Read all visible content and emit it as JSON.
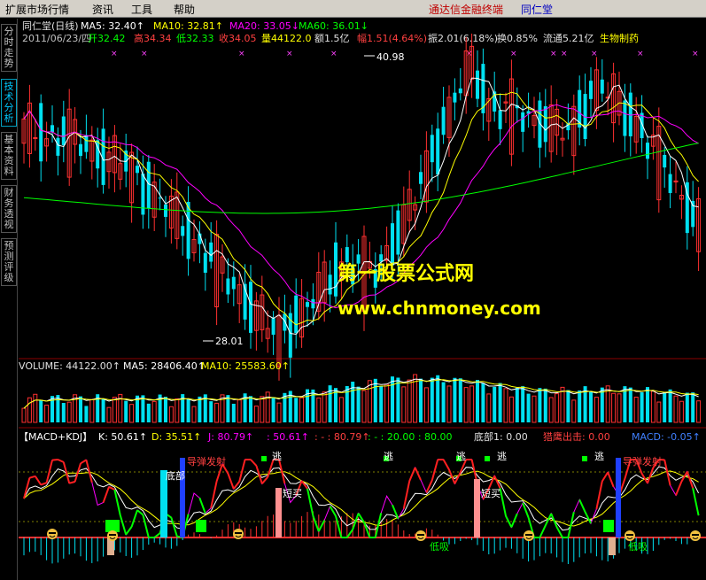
{
  "menu": {
    "items": [
      "扩展市场行情",
      "资讯",
      "工具",
      "帮助"
    ],
    "brand": "通达信金融终端",
    "stock": "同仁堂"
  },
  "side_tabs": [
    {
      "label": "分时走势",
      "active": false
    },
    {
      "label": "技术分析",
      "active": true
    },
    {
      "label": "基本资料",
      "active": false
    },
    {
      "label": "财务透视",
      "active": false
    },
    {
      "label": "预测评级",
      "active": false
    }
  ],
  "header": {
    "line1": [
      {
        "text": "同仁堂(日线)",
        "color": "#e0e0e0"
      },
      {
        "text": "MA5: 32.40↑",
        "color": "#ffffff"
      },
      {
        "text": "MA10: 32.81↑",
        "color": "#ffff00"
      },
      {
        "text": "MA20: 33.05↓",
        "color": "#ff00ff"
      },
      {
        "text": "MA60: 36.01↓",
        "color": "#00ff00"
      }
    ],
    "line2": [
      {
        "text": "2011/06/23/四",
        "color": "#c0c0c0"
      },
      {
        "text": "开32.42",
        "color": "#00ff00"
      },
      {
        "text": "高34.34",
        "color": "#ff4040"
      },
      {
        "text": "低32.33",
        "color": "#00ff00"
      },
      {
        "text": "收34.05",
        "color": "#ff4040"
      },
      {
        "text": "量44122.0",
        "color": "#ffff00"
      },
      {
        "text": "额1.5亿",
        "color": "#e0e0e0"
      },
      {
        "text": "幅1.51(4.64%)",
        "color": "#ff4040"
      },
      {
        "text": "振2.01(6.18%)",
        "color": "#e0e0e0"
      },
      {
        "text": "换0.85%",
        "color": "#e0e0e0"
      },
      {
        "text": "流通5.21亿",
        "color": "#e0e0e0"
      },
      {
        "text": "生物制药",
        "color": "#ffff00"
      }
    ]
  },
  "price_panel": {
    "high_label": "40.98",
    "low_label": "28.01",
    "watermark_title": "第一股票公式网",
    "watermark_url": "www.chnmoney.com"
  },
  "volume_panel": {
    "items": [
      {
        "text": "VOLUME: 44122.00↑",
        "color": "#e0e0e0"
      },
      {
        "text": "MA5: 28406.40↑",
        "color": "#ffffff"
      },
      {
        "text": "MA10: 25583.60↑",
        "color": "#ffff00"
      }
    ]
  },
  "macd_panel": {
    "items": [
      {
        "text": "【MACD+KDJ】",
        "color": "#ffffff"
      },
      {
        "text": "K: 50.61↑",
        "color": "#ffffff"
      },
      {
        "text": "D: 35.51↑",
        "color": "#ffff00"
      },
      {
        "text": "J: 80.79↑",
        "color": "#ff00ff"
      },
      {
        "text": ": 50.61↑",
        "color": "#ff00ff"
      },
      {
        "text": ": - : 80.79↑",
        "color": "#ff4040"
      },
      {
        "text": ": - : 20.00 : 80.00",
        "color": "#00ff00"
      },
      {
        "text": "底部1: 0.00",
        "color": "#e0e0e0"
      },
      {
        "text": "猎鹰出击: 0.00",
        "color": "#ff4040"
      },
      {
        "text": "MACD: -0.05↑",
        "color": "#4080ff"
      }
    ],
    "labels": {
      "bottom": "底部",
      "missile": "导弹发射",
      "escape": "逃",
      "short_buy": "短买",
      "low_buy": "低吸"
    }
  },
  "chart_data": {
    "type": "candlestick",
    "title": "同仁堂(日线)",
    "date": "2011/06/23/四",
    "high": 40.98,
    "low": 28.01,
    "last": {
      "open": 32.42,
      "high": 34.34,
      "low": 32.33,
      "close": 34.05,
      "volume": 44122.0
    },
    "ma": {
      "MA5": 32.4,
      "MA10": 32.81,
      "MA20": 33.05,
      "MA60": 36.01
    },
    "volume": {
      "VOLUME": 44122.0,
      "MA5": 28406.4,
      "MA10": 25583.6
    },
    "kdj": {
      "K": 50.61,
      "D": 35.51,
      "J": 80.79
    },
    "macd": -0.05
  },
  "colors": {
    "up": "#ff3030",
    "down": "#00e0f0",
    "ma5": "#ffffff",
    "ma10": "#ffff00",
    "ma20": "#ff00ff",
    "ma60": "#00ff00",
    "watermark": "#ffff00"
  }
}
